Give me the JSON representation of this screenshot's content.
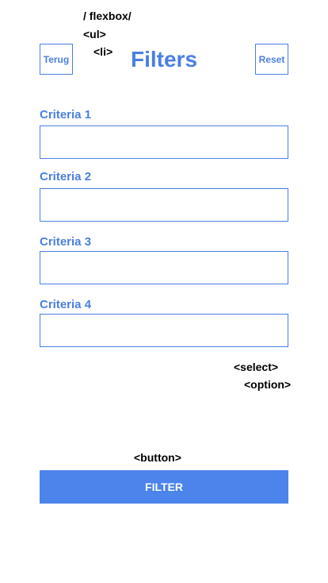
{
  "annotations": {
    "flexbox": "/ flexbox/",
    "ul": "<ul>",
    "li": "<li>",
    "select": "<select>",
    "option": "<option>",
    "button": "<button>"
  },
  "header": {
    "back_label": "Terug",
    "title": "Filters",
    "reset_label": "Reset"
  },
  "criteria": [
    {
      "label": "Criteria 1",
      "value": ""
    },
    {
      "label": "Criteria 2",
      "value": ""
    },
    {
      "label": "Criteria 3",
      "value": ""
    },
    {
      "label": "Criteria 4",
      "value": ""
    }
  ],
  "filter_button": {
    "label": "FILTER"
  },
  "colors": {
    "accent": "#4a7fe0",
    "button_fill": "#4d84ec",
    "annotation": "#000000"
  }
}
